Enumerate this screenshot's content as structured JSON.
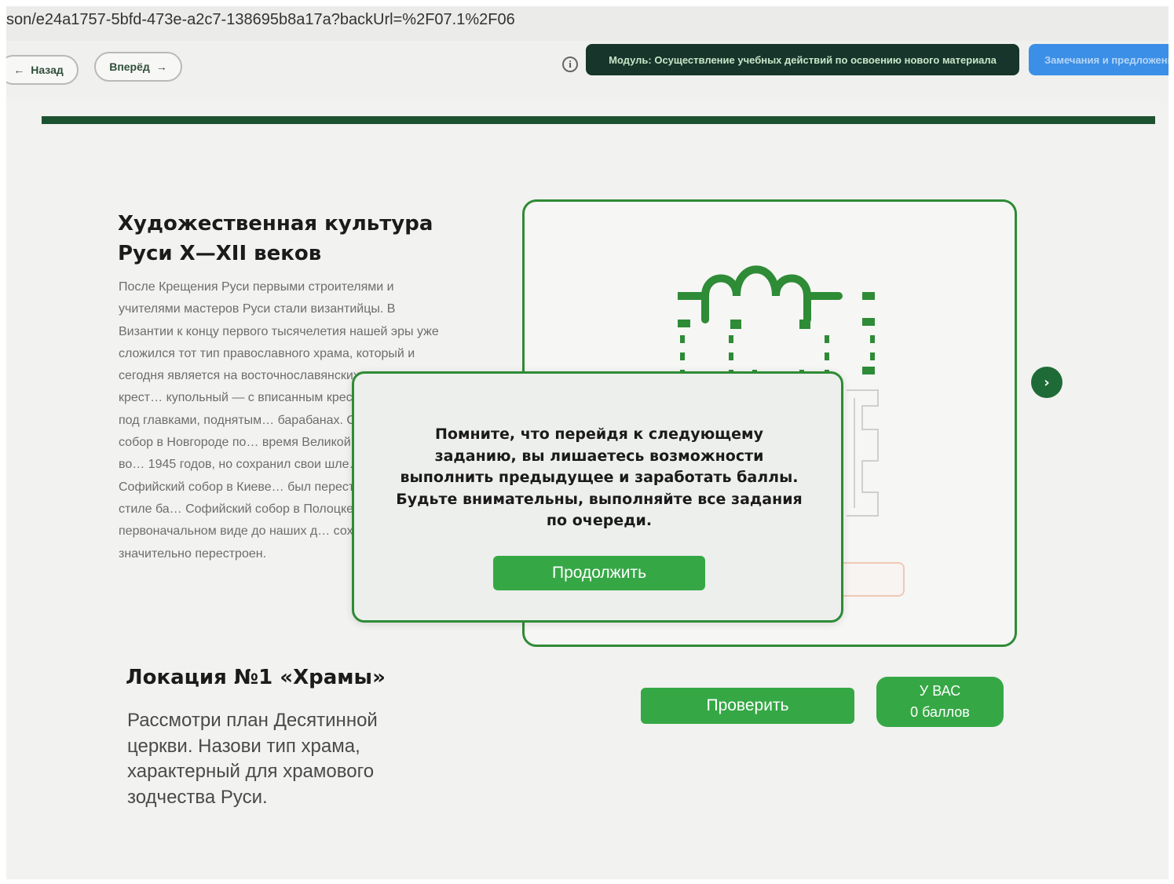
{
  "browser": {
    "url": "son/e24a1757-5bfd-473e-a2c7-138695b8a17a?backUrl=%2F07.1%2F06"
  },
  "navbar": {
    "back_label": "Назад",
    "forward_label": "Вперёд",
    "module_label": "Модуль: Осуществление учебных действий по освоению нового материала",
    "notes_label": "Замечания и предложения"
  },
  "lesson": {
    "title": "Художественная культура Руси X—XII веков",
    "body": "После Крещения Руси первыми строителями и учителями мастеров Руси стали византийцы. В Византии к концу первого тысячелетия нашей эры уже сложился тот тип православного храма, который и сегодня является на восточнославянских землях, крест… купольный — с вписанным крест… куполами под главками, поднятым… барабанах. Софийский собор в Новгороде по… время Великой Отечественной во… 1945 годов, но сохранил свои шле… купола; Софийский собор в Киеве… был перестроен в новом стиле ба… Софийский собор в Полоцке в его… первоначальном виде до наших д… сохранился, был значительно перестроен.",
    "location_title": "Локация №1 «Храмы»",
    "task": "Рассмотри план Десятинной церкви. Назови тип храма, характерный для храмового зодчества Руси."
  },
  "actions": {
    "check_label": "Проверить",
    "score_line1": "У ВАС",
    "score_line2": "0 баллов"
  },
  "modal": {
    "message": "Помните, что перейдя к следующему заданию, вы лишаетесь возможности выполнить предыдущее и заработать баллы. Будьте внимательны, выполняйте все задания по очереди.",
    "continue_label": "Продолжить"
  },
  "icons": {
    "back": "arrow-left-icon",
    "forward": "arrow-right-icon",
    "info": "info-icon",
    "next": "chevron-right-icon"
  },
  "colors": {
    "accent_green": "#35a845",
    "dark_green": "#1d5230",
    "module_bg": "#17352a",
    "notes_bg": "#3b8fe6"
  }
}
